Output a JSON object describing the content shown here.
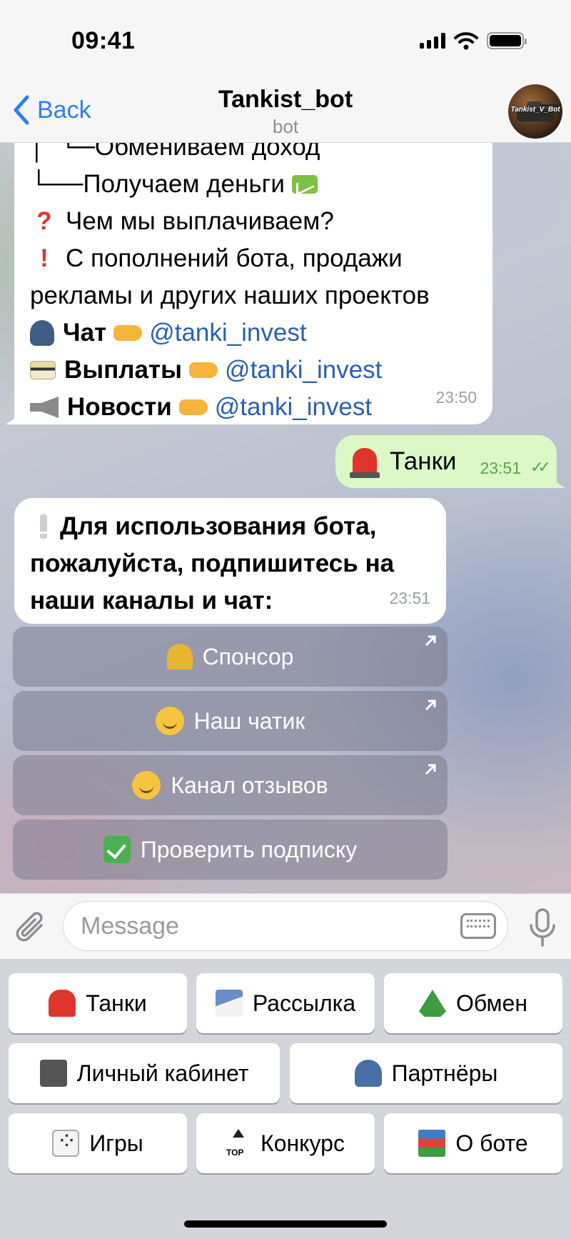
{
  "status_bar": {
    "time": "09:41"
  },
  "header": {
    "back_label": "Back",
    "title": "Tankist_bot",
    "subtitle": "bot",
    "avatar_text": "Tankist_V_Bot"
  },
  "messages": {
    "msg1": {
      "lines": {
        "l0": "Обмениваем доход",
        "l1": "Получаем деньги",
        "l2": "Чем мы выплачиваем?",
        "l3": "С пополнений бота, продажи",
        "l4": "рекламы и других наших проектов",
        "chat_label": "Чат",
        "payouts_label": "Выплаты",
        "news_label": "Новости",
        "link": "@tanki_invest"
      },
      "time": "23:50"
    },
    "out": {
      "text": "Танки",
      "time": "23:51"
    },
    "msg2": {
      "l1": "Для использования бота,",
      "l2": "пожалуйста, подпишитесь на",
      "l3": "наши каналы и чат:",
      "time": "23:51"
    },
    "inline_buttons": {
      "sponsor": "Спонсор",
      "our_chat": "Наш чатик",
      "reviews": "Канал отзывов",
      "check_sub": "Проверить подписку"
    }
  },
  "input": {
    "placeholder": "Message"
  },
  "keyboard": {
    "tanks": "Танки",
    "mailing": "Рассылка",
    "exchange": "Обмен",
    "cabinet": "Личный кабинет",
    "partners": "Партнёры",
    "games": "Игры",
    "contest": "Конкурс",
    "about": "О боте"
  },
  "colors": {
    "accent": "#2f7ef6",
    "outgoing": "#dcf8c6",
    "link": "#2a5fb8"
  }
}
